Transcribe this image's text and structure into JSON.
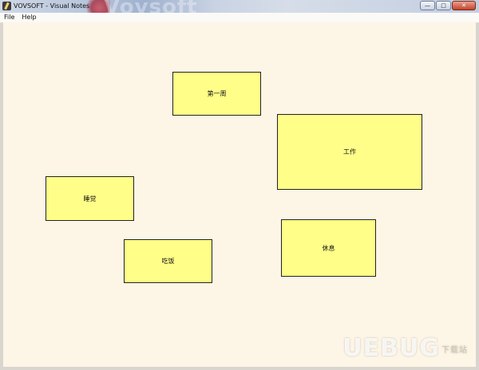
{
  "window": {
    "title": "VOVSOFT - Visual Notes",
    "background_brand": "Vovsoft",
    "controls": {
      "minimize": "—",
      "maximize": "□",
      "close": "✕"
    }
  },
  "menu": {
    "items": [
      {
        "label": "File"
      },
      {
        "label": "Help"
      }
    ]
  },
  "notes": [
    {
      "text": "第一周"
    },
    {
      "text": "工作"
    },
    {
      "text": "睡觉"
    },
    {
      "text": "休息"
    },
    {
      "text": "吃饭"
    }
  ],
  "watermark": {
    "text": "UEBUG",
    "suffix": "下载站"
  },
  "colors": {
    "canvas": "#fdf5e6",
    "note_fill": "#fffe88",
    "note_border": "#222222"
  }
}
